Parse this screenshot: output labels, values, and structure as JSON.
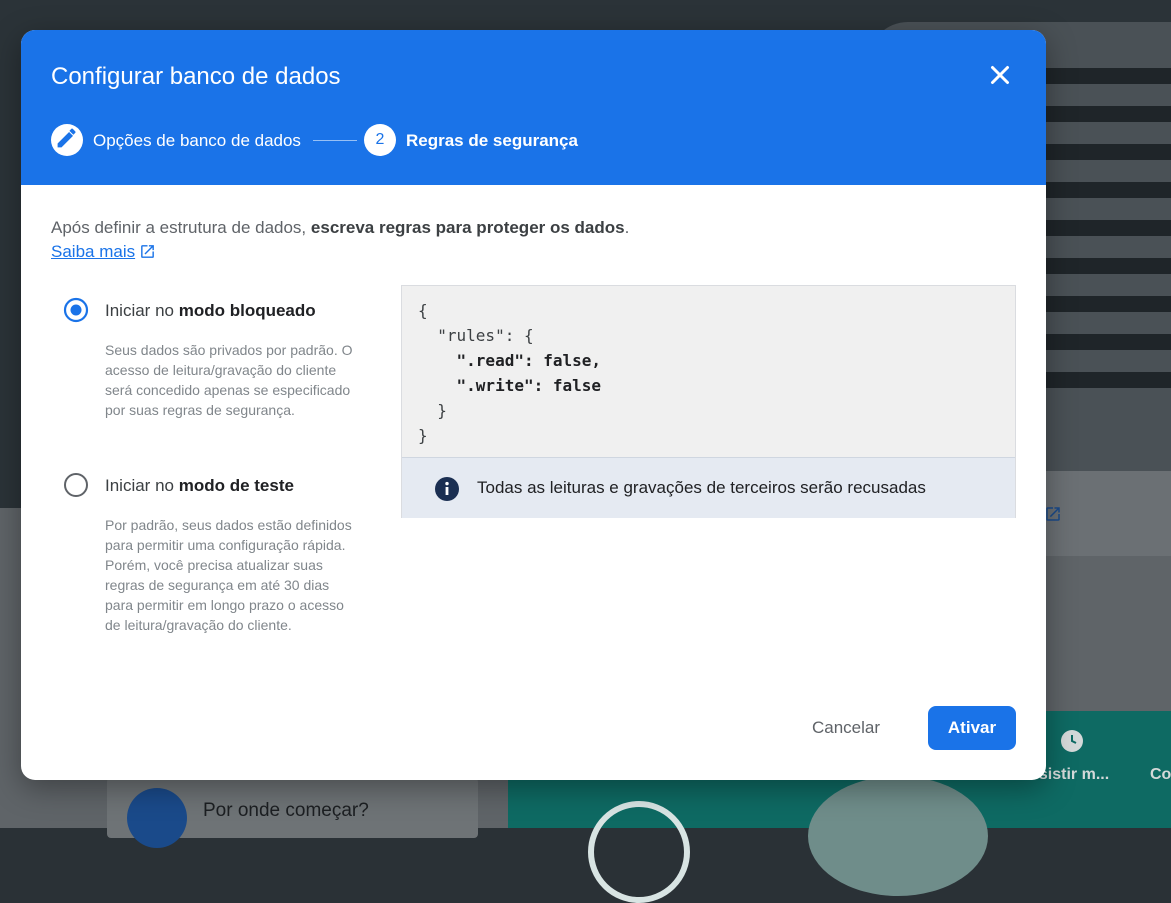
{
  "modal": {
    "title": "Configurar banco de dados",
    "steps": [
      {
        "label": "Opções de banco de dados",
        "icon": "pencil-icon"
      },
      {
        "number": "2",
        "label": "Regras de segurança"
      }
    ]
  },
  "intro": {
    "text": "Após definir a estrutura de dados,",
    "bold": "escreva regras para proteger os dados",
    "period": ".",
    "learn_more": "Saiba mais"
  },
  "options": [
    {
      "prefix": "Iniciar no",
      "bold": "modo bloqueado",
      "selected": true,
      "description": "Seus dados são privados por padrão. O acesso de leitura/gravação do cliente será concedido apenas se especificado por suas regras de segurança."
    },
    {
      "prefix": "Iniciar no",
      "bold": "modo de teste",
      "selected": false,
      "description": "Por padrão, seus dados estão definidos para permitir uma configuração rápida. Porém, você precisa atualizar suas regras de segurança em até 30 dias para permitir em longo prazo o acesso de leitura/gravação do cliente."
    }
  ],
  "code": {
    "line1": "{",
    "line2": "  \"rules\": {",
    "read_key": "\".read\"",
    "read_val": ": false,",
    "write_key": "\".write\"",
    "write_val": ": false",
    "line5": "  }",
    "line6": "}"
  },
  "notice": "Todas as leituras e gravações de terceiros serão recusadas",
  "buttons": {
    "cancel": "Cancelar",
    "activate": "Ativar"
  },
  "background": {
    "start_label": "Por onde começar?",
    "caption_1": "ssistir m...",
    "caption_2": "Co"
  },
  "colors": {
    "primary": "#1a73e8",
    "teal": "#0e6a63"
  }
}
